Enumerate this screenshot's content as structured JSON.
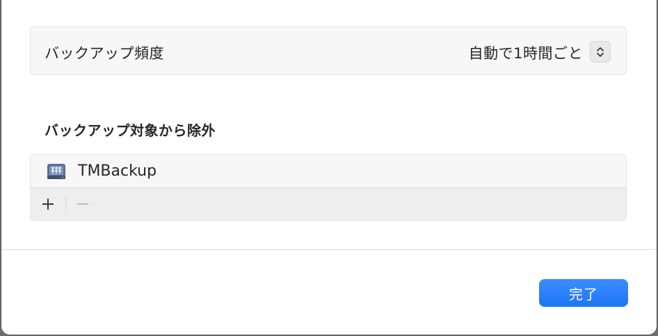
{
  "backup_frequency": {
    "label": "バックアップ頻度",
    "value": "自動で1時間ごと"
  },
  "exclusions": {
    "title": "バックアップ対象から除外",
    "items": [
      {
        "label": "TMBackup",
        "icon": "network-drive-icon"
      }
    ],
    "toolbar": {
      "add_icon": "plus-icon",
      "remove_icon": "minus-icon"
    }
  },
  "footer": {
    "done_label": "完了"
  },
  "colors": {
    "accent": "#1f76f5"
  }
}
